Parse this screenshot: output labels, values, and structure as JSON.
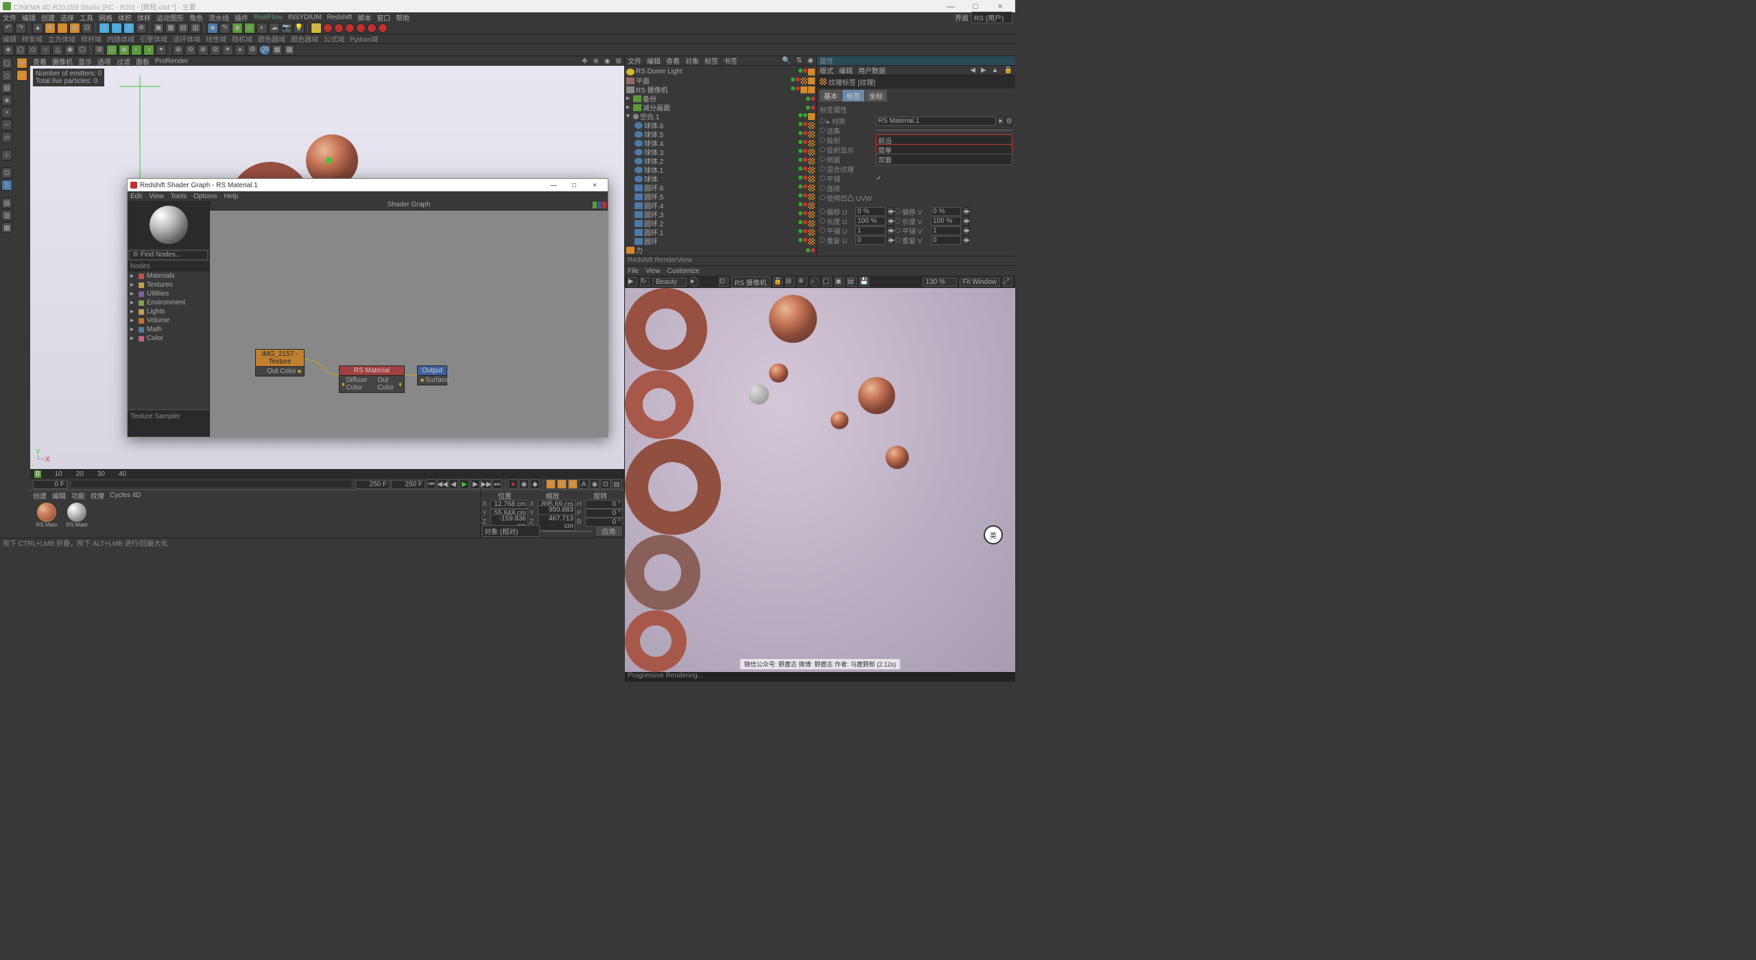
{
  "window": {
    "title": "CINEMA 4D R20.059 Studio (RC - R20) - [教程.c4d *] - 主要",
    "min": "—",
    "max": "□",
    "close": "×"
  },
  "topmenu": [
    "文件",
    "编辑",
    "创建",
    "选择",
    "工具",
    "网格",
    "体积",
    "体样",
    "运动图形",
    "角色",
    "流水线",
    "插件",
    "RealFlow",
    "INSYDIUM",
    "Redshift",
    "脚本",
    "窗口",
    "帮助"
  ],
  "layout_label": "界面",
  "layout_value": "RS (用户)",
  "toolbar2": [
    "编辑",
    "样条域",
    "立方体域",
    "样杆域",
    "内随体域",
    "引擎体域",
    "适环体域",
    "线性域",
    "随机域",
    "跟色器域",
    "跟色器域",
    "公式域",
    "Python域"
  ],
  "vp_menu": [
    "查看",
    "摄像机",
    "显示",
    "选项",
    "过滤",
    "面板",
    "ProRender"
  ],
  "vp_overlay1": "Number of emitters: 0",
  "vp_overlay2": "Total live particles: 0",
  "axis": {
    "y": "Y",
    "x": "X"
  },
  "timeline": {
    "marks": [
      "0",
      "10",
      "20",
      "30",
      "40"
    ],
    "start": "0 F",
    "end": "250 F",
    "end2": "250 F"
  },
  "mat_menu": [
    "创建",
    "编辑",
    "功能",
    "纹理",
    "Cycles 4D"
  ],
  "materials": [
    {
      "name": "RS Mate"
    },
    {
      "name": "RS Mate"
    }
  ],
  "coord": {
    "headers": [
      "位置",
      "缩放",
      "旋转"
    ],
    "rows": [
      {
        "a": "X",
        "p": "12.768 cm",
        "s": "X",
        "sv": "895.69 cm",
        "r": "H",
        "rv": "0 °"
      },
      {
        "a": "Y",
        "p": "55.848 cm",
        "s": "Y",
        "sv": "950.883 cm",
        "r": "P",
        "rv": "0 °"
      },
      {
        "a": "Z",
        "p": "-159.836 cm",
        "s": "Z",
        "sv": "467.713 cm",
        "r": "B",
        "rv": "0 °"
      }
    ],
    "mode": "对象 (相对)",
    "apply": "应用"
  },
  "obj_menu": [
    "文件",
    "编辑",
    "查看",
    "对象",
    "标签",
    "书签"
  ],
  "objects": [
    {
      "name": "RS Dome Light",
      "icon": "light",
      "indent": 0,
      "tags": [
        "dot",
        "reddot",
        "sq"
      ]
    },
    {
      "name": "平面",
      "icon": "plane",
      "indent": 0,
      "tags": [
        "dot",
        "reddot",
        "chk",
        "sq"
      ]
    },
    {
      "name": "RS 摄像机",
      "icon": "cam",
      "indent": 0,
      "tags": [
        "dot",
        "reddot",
        "sq",
        "sq"
      ]
    },
    {
      "name": "备份",
      "icon": "cube",
      "indent": 0,
      "expand": "▸",
      "tags": [
        "dot",
        "reddot"
      ]
    },
    {
      "name": "减分画面",
      "icon": "cube",
      "indent": 0,
      "expand": "▸",
      "tags": [
        "dot",
        "reddot"
      ]
    },
    {
      "name": "空白.1",
      "icon": "null",
      "indent": 0,
      "expand": "▾",
      "tags": [
        "dot",
        "dot",
        "sel"
      ]
    },
    {
      "name": "球体.6",
      "icon": "sphere",
      "indent": 1,
      "tags": [
        "dot",
        "reddot",
        "chk"
      ]
    },
    {
      "name": "球体.5",
      "icon": "sphere",
      "indent": 1,
      "tags": [
        "dot",
        "reddot",
        "chk"
      ]
    },
    {
      "name": "球体.4",
      "icon": "sphere",
      "indent": 1,
      "tags": [
        "dot",
        "reddot",
        "chk"
      ]
    },
    {
      "name": "球体.3",
      "icon": "sphere",
      "indent": 1,
      "tags": [
        "dot",
        "reddot",
        "chk"
      ]
    },
    {
      "name": "球体.2",
      "icon": "sphere",
      "indent": 1,
      "tags": [
        "dot",
        "reddot",
        "chk"
      ]
    },
    {
      "name": "球体.1",
      "icon": "sphere",
      "indent": 1,
      "tags": [
        "dot",
        "reddot",
        "chk"
      ]
    },
    {
      "name": "球体",
      "icon": "sphere",
      "indent": 1,
      "tags": [
        "dot",
        "reddot",
        "chk"
      ]
    },
    {
      "name": "圆环.6",
      "icon": "torus",
      "indent": 1,
      "tags": [
        "dot",
        "reddot",
        "chk"
      ]
    },
    {
      "name": "圆环.5",
      "icon": "torus",
      "indent": 1,
      "tags": [
        "dot",
        "reddot",
        "chk"
      ]
    },
    {
      "name": "圆环.4",
      "icon": "torus",
      "indent": 1,
      "tags": [
        "dot",
        "reddot",
        "chk"
      ]
    },
    {
      "name": "圆环.3",
      "icon": "torus",
      "indent": 1,
      "tags": [
        "dot",
        "reddot",
        "chk"
      ]
    },
    {
      "name": "圆环.2",
      "icon": "torus",
      "indent": 1,
      "tags": [
        "dot",
        "reddot",
        "chk"
      ]
    },
    {
      "name": "圆环.1",
      "icon": "torus",
      "indent": 1,
      "tags": [
        "dot",
        "reddot",
        "chk"
      ]
    },
    {
      "name": "圆环",
      "icon": "torus",
      "indent": 1,
      "tags": [
        "dot",
        "reddot",
        "chk"
      ]
    },
    {
      "name": "力",
      "icon": "force",
      "indent": 0,
      "tags": [
        "dot",
        "reddot"
      ]
    }
  ],
  "attr": {
    "menu": [
      "模式",
      "编辑",
      "用户数据"
    ],
    "title": "纹理标签 [纹理]",
    "tabs": [
      "基本",
      "标签",
      "坐标"
    ],
    "section": "标签属性",
    "fields": [
      {
        "lbl": "▸ 材质",
        "val": "RS Material.1",
        "buttons": true
      },
      {
        "lbl": "选集",
        "val": ""
      },
      {
        "lbl": "投射",
        "val": "前沿",
        "hl": true
      },
      {
        "lbl": "投射显示",
        "val": "简单",
        "hl": true
      },
      {
        "lbl": "侧面",
        "val": "双面"
      },
      {
        "lbl": "混合纹理",
        "chk": false
      },
      {
        "lbl": "平铺",
        "chk": true
      },
      {
        "lbl": "连续",
        "chk": false
      },
      {
        "lbl": "使用凹凸 UVW",
        "chk": false
      }
    ],
    "grid": [
      {
        "l1": "偏移 U",
        "v1": "0 %",
        "l2": "偏移 V",
        "v2": "0 %"
      },
      {
        "l1": "长度 U",
        "v1": "100 %",
        "l2": "长度 V",
        "v2": "100 %"
      },
      {
        "l1": "平铺 U",
        "v1": "1",
        "l2": "平铺 V",
        "v2": "1"
      },
      {
        "l1": "重复 U",
        "v1": "0",
        "l2": "重复 V",
        "v2": "0"
      }
    ]
  },
  "render": {
    "title": "Redshift RenderView",
    "menu": [
      "File",
      "View",
      "Customize"
    ],
    "beauty": "Beauty",
    "camera": "RS 摄像机",
    "scale": "130 %",
    "fit": "Fit Window",
    "watermark": "微信公众号: 野鹿志    微博: 野鹿志    作者: 马鹿野郎   (2.12s)",
    "status": "Progressive Rendering..."
  },
  "status": "按下 CTRL+LMB 折叠，按下 ALT+LMB 进行/回最大化",
  "modal": {
    "title": "Redshift Shader Graph - RS Material.1",
    "menu": [
      "Edit",
      "View",
      "Tools",
      "Options",
      "Help"
    ],
    "find": "Find Nodes...",
    "nodes_hdr": "Nodes",
    "cats": [
      {
        "c": "red",
        "n": "Materials"
      },
      {
        "c": "yellow",
        "n": "Textures"
      },
      {
        "c": "purple",
        "n": "Utilities"
      },
      {
        "c": "green",
        "n": "Environment"
      },
      {
        "c": "yellow",
        "n": "Lights"
      },
      {
        "c": "orange",
        "n": "Volume"
      },
      {
        "c": "blue",
        "n": "Math"
      },
      {
        "c": "pink",
        "n": "Color"
      }
    ],
    "sampler": "Texture Sampler",
    "graph_hdr": "Shader Graph",
    "n1": {
      "title": "IMG_2157 - Texture",
      "out": "Out Color"
    },
    "n2": {
      "title": "RS Material",
      "in": "Diffuse Color",
      "out": "Out Color"
    },
    "n3": {
      "title": "Output",
      "in": "Surface"
    }
  },
  "ime": "英"
}
